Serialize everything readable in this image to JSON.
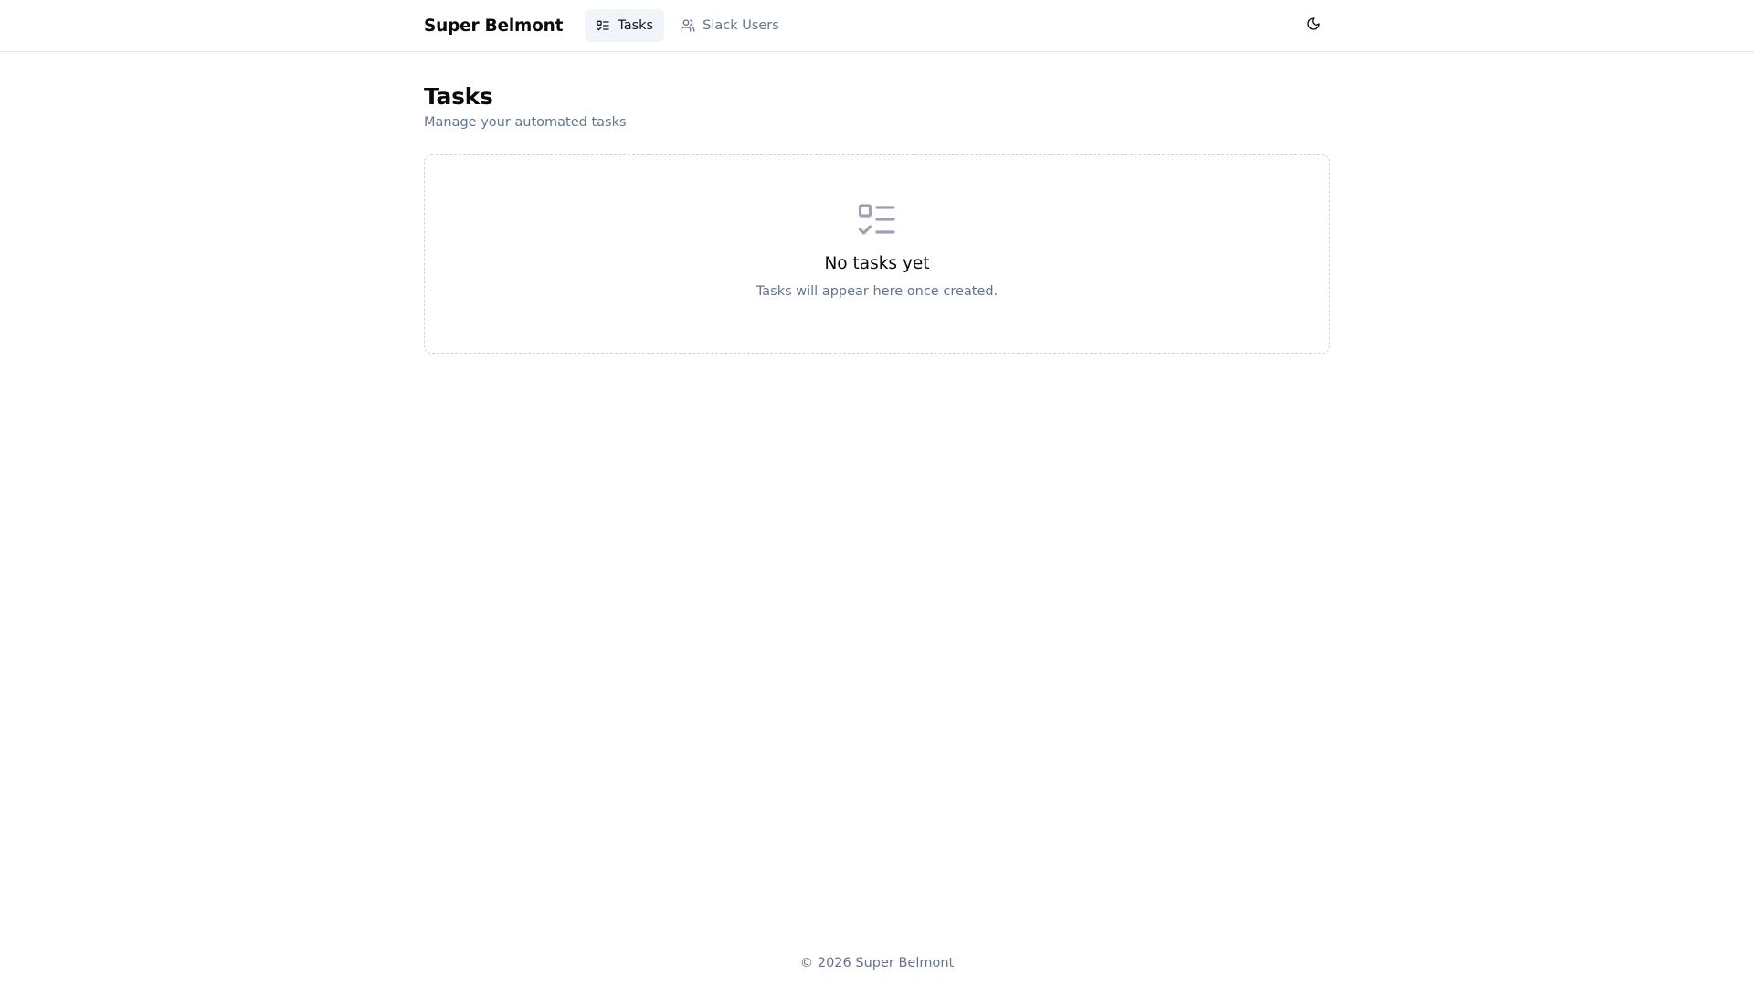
{
  "header": {
    "brand": "Super Belmont",
    "nav": [
      {
        "label": "Tasks",
        "icon": "list-checks-icon",
        "active": true
      },
      {
        "label": "Slack Users",
        "icon": "users-icon",
        "active": false
      }
    ],
    "theme_toggle_icon": "moon-icon"
  },
  "main": {
    "title": "Tasks",
    "subtitle": "Manage your automated tasks",
    "empty_state": {
      "icon": "list-checks-icon",
      "title": "No tasks yet",
      "description": "Tasks will appear here once created."
    }
  },
  "footer": {
    "text": "© 2026 Super Belmont"
  },
  "colors": {
    "text_primary": "#0a0a0a",
    "text_muted": "#64748b",
    "active_nav_bg": "#f1f5f9",
    "border": "#e5e7eb",
    "icon_muted": "#9ca3af"
  }
}
